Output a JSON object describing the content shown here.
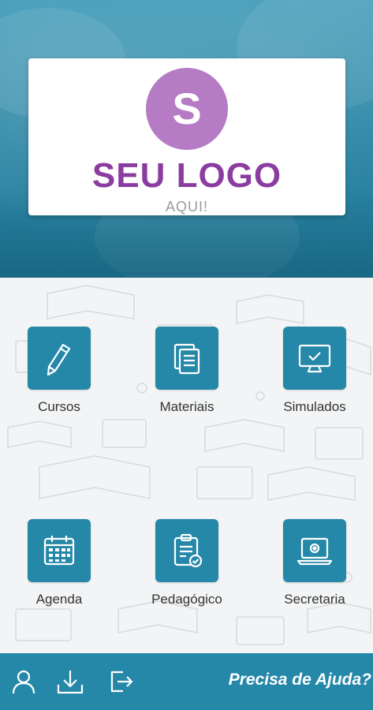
{
  "logo": {
    "letter": "S",
    "title": "SEU LOGO",
    "subtitle": "AQUI!"
  },
  "menu": [
    {
      "label": "Cursos",
      "icon": "pencil-icon"
    },
    {
      "label": "Materiais",
      "icon": "documents-icon"
    },
    {
      "label": "Simulados",
      "icon": "monitor-check-icon"
    },
    {
      "label": "Agenda",
      "icon": "calendar-icon"
    },
    {
      "label": "Pedagógico",
      "icon": "clipboard-check-icon"
    },
    {
      "label": "Secretaria",
      "icon": "laptop-icon"
    }
  ],
  "bottom_bar": {
    "icons": [
      "user-icon",
      "download-icon",
      "logout-icon"
    ],
    "help_label": "Precisa de Ajuda?"
  },
  "colors": {
    "primary": "#2588a8",
    "logo_purple": "#8b3ca0",
    "logo_circle": "#b57bc4"
  }
}
